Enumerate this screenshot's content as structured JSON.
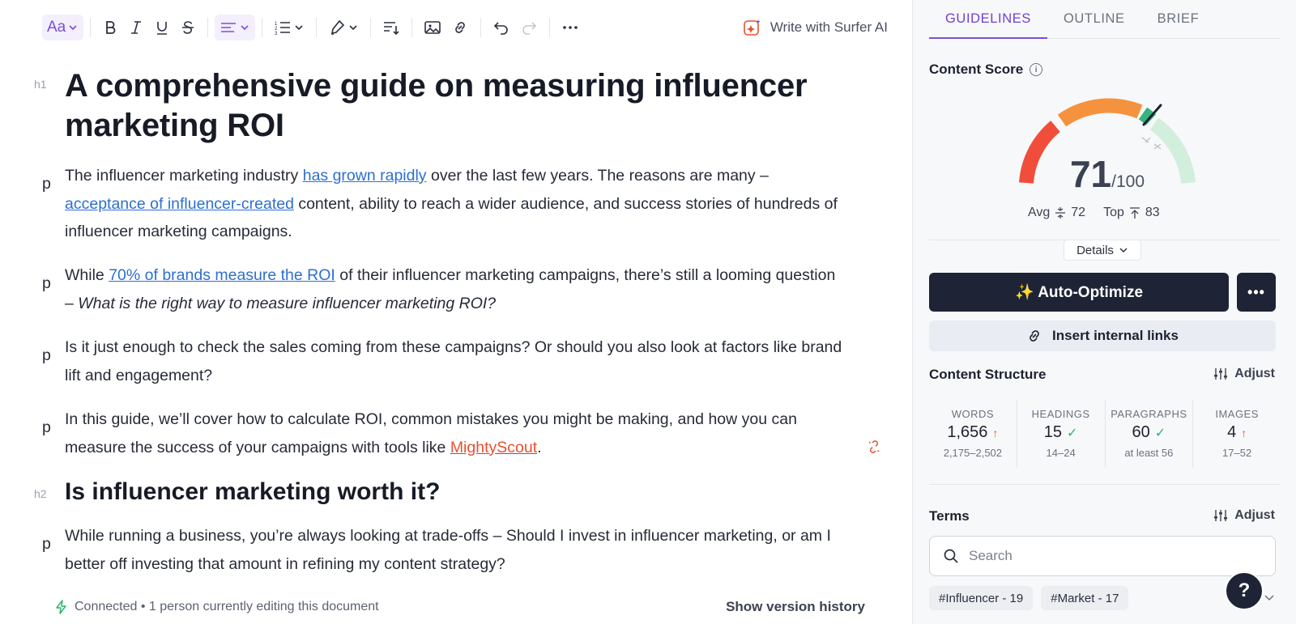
{
  "toolbar": {
    "font_label": "Aa",
    "icons": [
      "text-style-icon",
      "bold-icon",
      "italic-icon",
      "underline-icon",
      "strikethrough-icon",
      "align-icon",
      "numbered-list-icon",
      "highlighter-icon",
      "sort-icon",
      "image-icon",
      "link-icon",
      "undo-icon",
      "redo-icon",
      "more-icon"
    ],
    "write_ai_label": "Write with Surfer AI"
  },
  "doc": {
    "h1_tag": "h1",
    "title": "A comprehensive guide on measuring influencer marketing ROI",
    "p_tag": "p",
    "h2_tag": "h2",
    "p1": {
      "t1": "The influencer marketing industry ",
      "l1": "has grown rapidly",
      "t2": " over the last few years. The reasons are many – ",
      "l2": "acceptance of influencer-created",
      "t3": " content, ability to reach a wider audience, and success stories of hundreds of influencer marketing campaigns."
    },
    "p2": {
      "t1": "While ",
      "l1": "70% of brands measure the ROI",
      "t2": " of their influencer marketing campaigns, there’s still a looming question – ",
      "em": "What is the right way to measure influencer marketing ROI?"
    },
    "p3": "Is it just enough to check the sales coming from these campaigns? Or should you also look at factors like brand lift and engagement?",
    "p4": {
      "t1": "In this guide, we’ll cover how to calculate ROI, common mistakes you might be making, and how you can measure the success of your campaigns with tools like ",
      "l1": "MightyScout",
      "t2": "."
    },
    "h2": "Is influencer marketing worth it?",
    "p5": "While running a business, you’re always looking at trade-offs – Should I invest in influencer marketing, or am I better off investing that amount in refining my content strategy?"
  },
  "status": {
    "connection": "Connected • 1 person currently editing this document",
    "version_history": "Show version history"
  },
  "panel": {
    "tabs": [
      "GUIDELINES",
      "OUTLINE",
      "BRIEF"
    ],
    "active_tab": "GUIDELINES",
    "content_score_title": "Content Score",
    "score": "71",
    "score_max": "/100",
    "score_value": 71,
    "avg_label": "Avg",
    "avg_value": "72",
    "top_label": "Top",
    "top_value": "83",
    "details_label": "Details",
    "auto_optimize_label": "✨ Auto-Optimize",
    "more_label": "•••",
    "insert_links_label": "Insert internal links",
    "content_structure_title": "Content Structure",
    "adjust_label": "Adjust",
    "stats": [
      {
        "label": "WORDS",
        "value": "1,656",
        "status": "up",
        "range": "2,175–2,502"
      },
      {
        "label": "HEADINGS",
        "value": "15",
        "status": "ok",
        "range": "14–24"
      },
      {
        "label": "PARAGRAPHS",
        "value": "60",
        "status": "ok",
        "range": "at least 56"
      },
      {
        "label": "IMAGES",
        "value": "4",
        "status": "up",
        "range": "17–52"
      }
    ],
    "terms_title": "Terms",
    "search_placeholder": "Search",
    "chips": [
      "#Influencer - 19",
      "#Market - 17"
    ],
    "help_label": "?"
  },
  "colors": {
    "accent": "#7c4ddb",
    "dark": "#1e2435",
    "link": "#2d6fd1",
    "warning": "#e8502f",
    "gauge_red": "#f04e3a",
    "gauge_orange": "#f5923e",
    "gauge_green": "#36b37e",
    "gauge_light_green": "#d2eedd"
  }
}
